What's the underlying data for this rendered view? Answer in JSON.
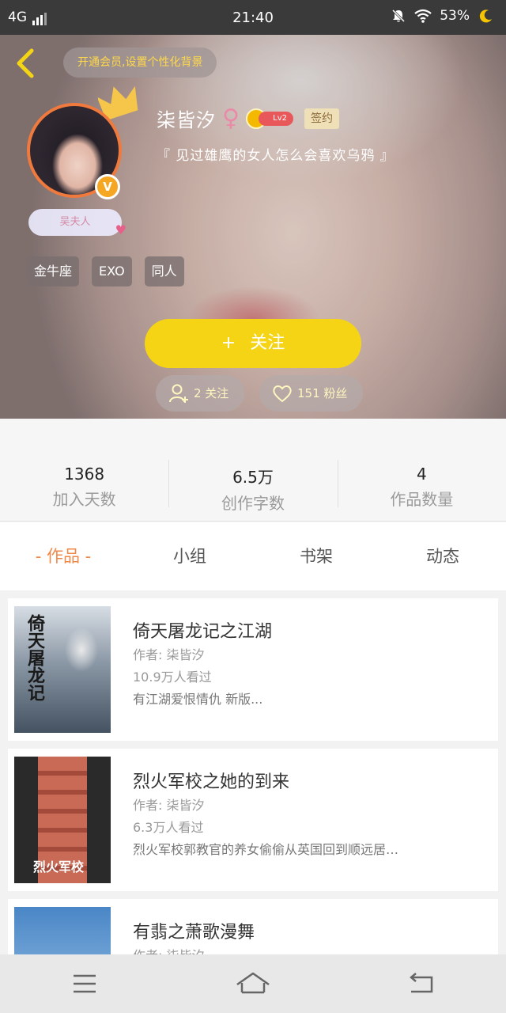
{
  "status_bar": {
    "network": "4G",
    "time": "21:40",
    "battery": "53%"
  },
  "header": {
    "vip_prompt": "开通会员,设置个性化背景",
    "nickname": "柒皆汐",
    "gender_symbol": "♀",
    "level": "Lv2",
    "sign_badge": "签约",
    "verified_badge": "V",
    "motto": "『 见过雄鹰的女人怎么会喜欢乌鸦 』",
    "fan_title": "吴夫人",
    "tags": [
      "金牛座",
      "EXO",
      "同人"
    ],
    "follow_button": "关注",
    "follow_plus": "+",
    "following_count": "2 关注",
    "fans_count": "151 粉丝"
  },
  "stats": [
    {
      "value": "1368",
      "label": "加入天数"
    },
    {
      "value": "6.5万",
      "label": "创作字数"
    },
    {
      "value": "4",
      "label": "作品数量"
    }
  ],
  "tabs": [
    {
      "label": "- 作品 -",
      "active": true
    },
    {
      "label": "小组",
      "active": false
    },
    {
      "label": "书架",
      "active": false
    },
    {
      "label": "动态",
      "active": false
    }
  ],
  "works": [
    {
      "title": "倚天屠龙记之江湖",
      "author": "作者: 柒皆汐",
      "views": "10.9万人看过",
      "desc": "有江湖爱恨情仇 新版...",
      "cover_text": "倚天屠龙记"
    },
    {
      "title": "烈火军校之她的到来",
      "author": "作者: 柒皆汐",
      "views": "6.3万人看过",
      "desc": "烈火军校郭教官的养女偷偷从英国回到顺远居…",
      "cover_text": "烈火军校"
    },
    {
      "title": "有翡之萧歌漫舞",
      "author": "作者: 柒皆汐",
      "views": "",
      "desc": "",
      "cover_text": ""
    }
  ],
  "colors": {
    "accent_orange": "#f08848",
    "follow_yellow": "#f5d416",
    "vip_text": "#ffd94a"
  },
  "icons": {
    "back": "chevron-left-icon",
    "crown": "crown-icon",
    "follow_user": "user-plus-icon",
    "fans": "heart-outline-icon",
    "nav_menu": "menu-icon",
    "nav_home": "home-icon",
    "nav_back": "return-icon"
  }
}
